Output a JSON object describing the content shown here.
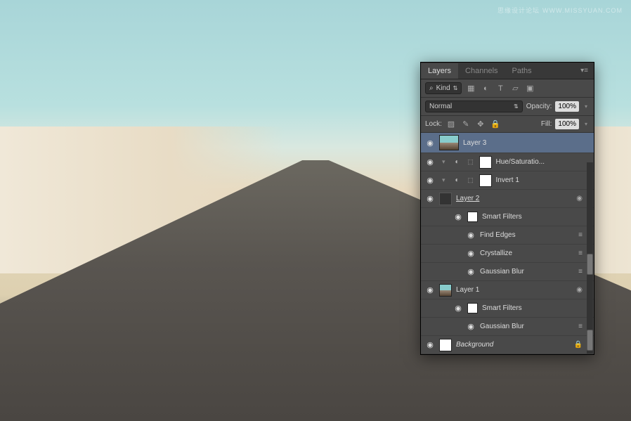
{
  "watermark": {
    "main": "思缘设计论坛",
    "url": "WWW.MISSYUAN.COM"
  },
  "tabs": {
    "layers": "Layers",
    "channels": "Channels",
    "paths": "Paths"
  },
  "filter": {
    "kind": "Kind"
  },
  "blend": {
    "mode": "Normal",
    "opacity_label": "Opacity:",
    "opacity": "100%"
  },
  "lock": {
    "label": "Lock:",
    "fill_label": "Fill:",
    "fill": "100%"
  },
  "layers": {
    "l3": "Layer 3",
    "huesat": "Hue/Saturatio...",
    "invert": "Invert 1",
    "l2": "Layer 2",
    "sf": "Smart Filters",
    "find": "Find Edges",
    "cryst": "Crystallize",
    "gblur": "Gaussian Blur",
    "l1": "Layer 1",
    "bg": "Background"
  }
}
